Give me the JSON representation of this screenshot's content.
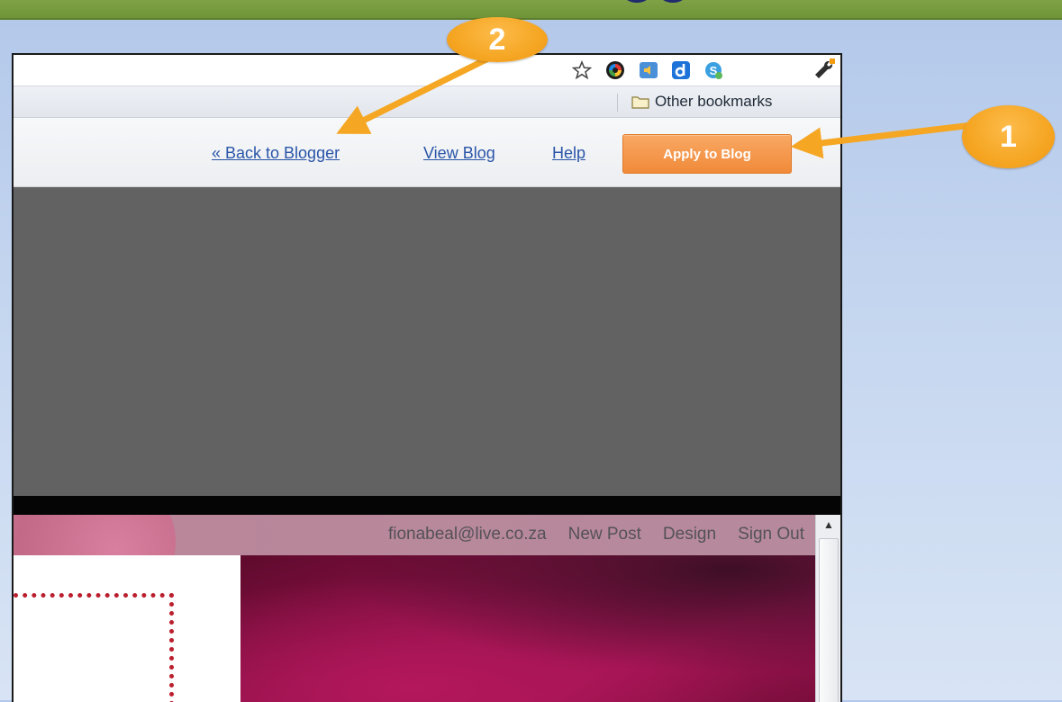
{
  "bookmarks": {
    "other_label": "Other bookmarks"
  },
  "toolbar_icons": [
    "star-icon",
    "chrome-color-icon",
    "speaker-icon",
    "d-app-icon",
    "skype-icon",
    "wrench-icon"
  ],
  "designer_nav": {
    "back_link": "« Back to Blogger",
    "view_blog": "View Blog",
    "help": "Help",
    "apply_button": "Apply to Blog"
  },
  "blog_nav": {
    "email": "fionabeal@live.co.za",
    "new_post": "New Post",
    "design": "Design",
    "sign_out": "Sign Out"
  },
  "callouts": {
    "first": "1",
    "second": "2"
  },
  "colors": {
    "accent_orange": "#f5a623",
    "link_blue": "#2a55a8",
    "top_bar_green": "#7fa246"
  }
}
